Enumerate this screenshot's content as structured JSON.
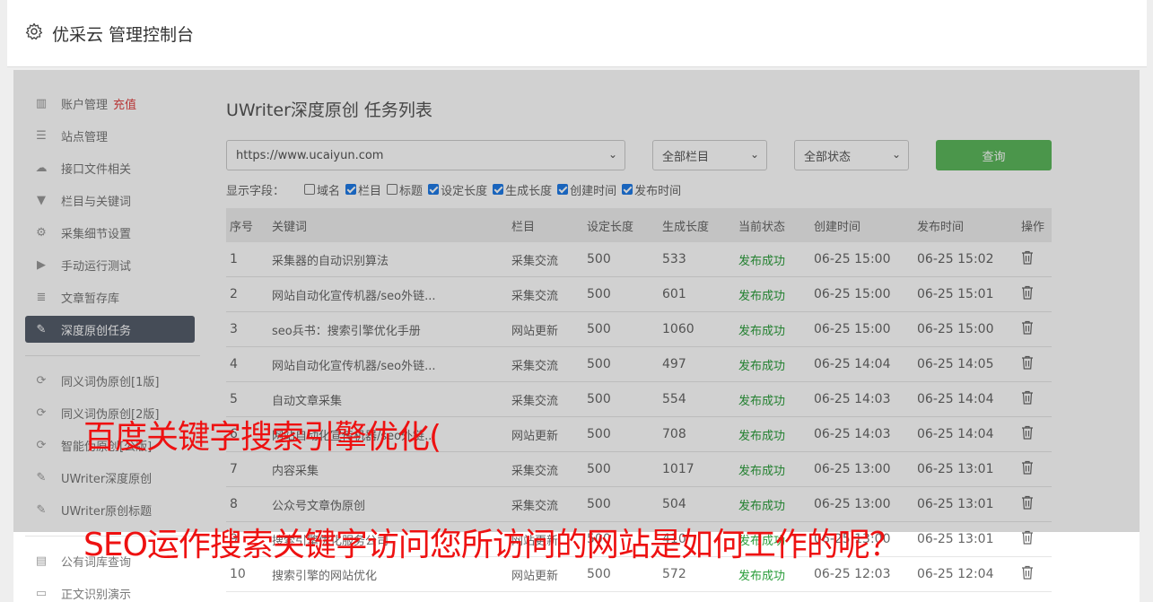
{
  "header": {
    "title": "优采云 管理控制台",
    "icon": "gear-icon"
  },
  "sidebar": {
    "items": [
      {
        "label": "账户管理",
        "extra": "充值",
        "icon": "bar-chart-icon",
        "glyph": "▥"
      },
      {
        "label": "站点管理",
        "icon": "server-icon",
        "glyph": "☰"
      },
      {
        "label": "接口文件相关",
        "icon": "cloud-upload-icon",
        "glyph": "☁"
      },
      {
        "label": "栏目与关键词",
        "icon": "filter-icon",
        "glyph": "▼"
      },
      {
        "label": "采集细节设置",
        "icon": "cogs-icon",
        "glyph": "⚙"
      },
      {
        "label": "手动运行测试",
        "icon": "play-circle-icon",
        "glyph": "▶"
      },
      {
        "label": "文章暂存库",
        "icon": "database-icon",
        "glyph": "≣"
      },
      {
        "label": "深度原创任务",
        "icon": "edit-icon",
        "glyph": "✎",
        "active": true
      },
      {
        "label": "同义词伪原创[1版]",
        "icon": "refresh-icon",
        "glyph": "⟳"
      },
      {
        "label": "同义词伪原创[2版]",
        "icon": "refresh-icon",
        "glyph": "⟳"
      },
      {
        "label": "智能伪原创[公版]",
        "icon": "refresh-icon",
        "glyph": "⟳"
      },
      {
        "label": "UWriter深度原创",
        "icon": "edit-icon",
        "glyph": "✎"
      },
      {
        "label": "UWriter原创标题",
        "icon": "edit-icon",
        "glyph": "✎"
      },
      {
        "label": "公有词库查询",
        "icon": "book-icon",
        "glyph": "▤"
      },
      {
        "label": "正文识别演示",
        "icon": "monitor-icon",
        "glyph": "▭"
      }
    ]
  },
  "main": {
    "title": "UWriter深度原创 任务列表",
    "site_select": "https://www.ucaiyun.com",
    "column_select": "全部栏目",
    "status_select": "全部状态",
    "query_button": "查询",
    "fields_label": "显示字段：",
    "fields": [
      {
        "label": "域名",
        "checked": false
      },
      {
        "label": "栏目",
        "checked": true
      },
      {
        "label": "标题",
        "checked": false
      },
      {
        "label": "设定长度",
        "checked": true
      },
      {
        "label": "生成长度",
        "checked": true
      },
      {
        "label": "创建时间",
        "checked": true
      },
      {
        "label": "发布时间",
        "checked": true
      }
    ]
  },
  "table": {
    "headers": [
      "序号",
      "关键词",
      "栏目",
      "设定长度",
      "生成长度",
      "当前状态",
      "创建时间",
      "发布时间",
      "操作"
    ],
    "rows": [
      [
        "1",
        "采集器的自动识别算法",
        "采集交流",
        "500",
        "533",
        "发布成功",
        "06-25 15:00",
        "06-25 15:02"
      ],
      [
        "2",
        "网站自动化宣传机器/seo外链...",
        "采集交流",
        "500",
        "601",
        "发布成功",
        "06-25 15:00",
        "06-25 15:01"
      ],
      [
        "3",
        "seo兵书：搜索引擎优化手册",
        "网站更新",
        "500",
        "1060",
        "发布成功",
        "06-25 15:00",
        "06-25 15:00"
      ],
      [
        "4",
        "网站自动化宣传机器/seo外链...",
        "采集交流",
        "500",
        "497",
        "发布成功",
        "06-25 14:04",
        "06-25 14:05"
      ],
      [
        "5",
        "自动文章采集",
        "采集交流",
        "500",
        "554",
        "发布成功",
        "06-25 14:03",
        "06-25 14:04"
      ],
      [
        "6",
        "网站自动化宣传机器/seo外链...",
        "网站更新",
        "500",
        "708",
        "发布成功",
        "06-25 14:03",
        "06-25 14:04"
      ],
      [
        "7",
        "内容采集",
        "采集交流",
        "500",
        "1017",
        "发布成功",
        "06-25 13:00",
        "06-25 13:01"
      ],
      [
        "8",
        "公众号文章伪原创",
        "采集交流",
        "500",
        "504",
        "发布成功",
        "06-25 13:00",
        "06-25 13:01"
      ],
      [
        "9",
        "搜索引擎优化服务公司",
        "网站更新",
        "500",
        "410",
        "发布成功",
        "06-25 13:00",
        "06-25 13:01"
      ],
      [
        "10",
        "搜索引擎的网站优化",
        "网站更新",
        "500",
        "572",
        "发布成功",
        "06-25 12:03",
        "06-25 12:04"
      ]
    ]
  },
  "watermark": {
    "line1": "百度关键字搜索引擎优化(",
    "line2": "SEO运作搜索关键字访问您所访问的网站是如何工作的呢？"
  },
  "colors": {
    "active_nav": "#555d6b",
    "success": "#2a9d3a",
    "recharge": "#e04444",
    "query_button": "#5cb85c",
    "watermark": "#ee1111"
  }
}
